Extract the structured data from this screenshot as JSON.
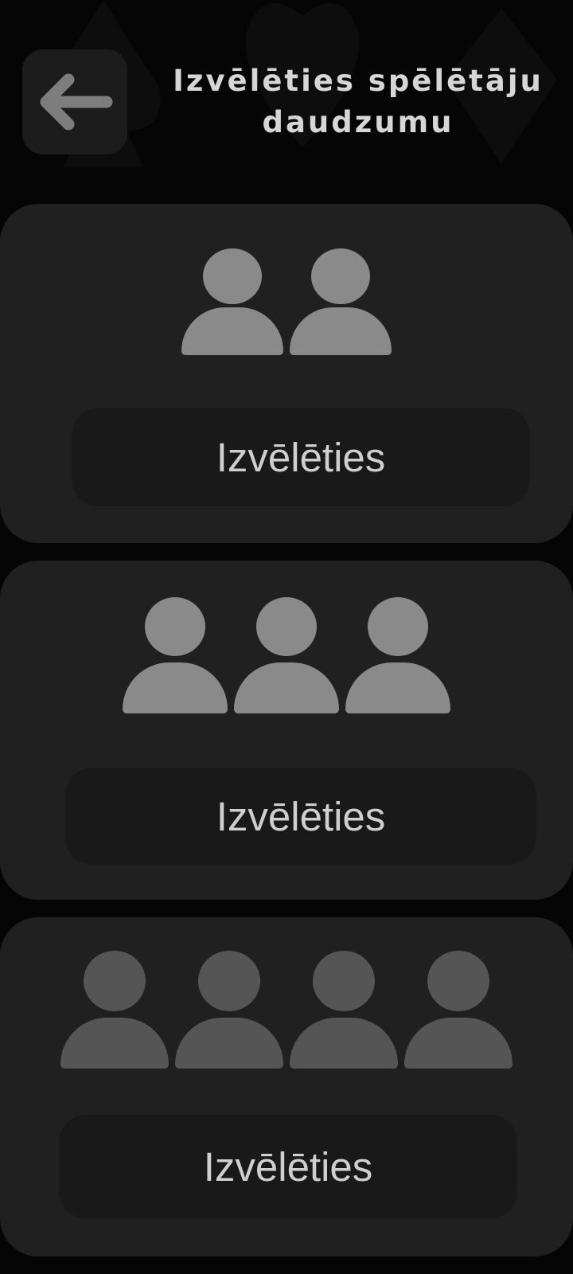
{
  "header": {
    "title_line1": "Izvēlēties spēlētāju",
    "title_line2": "daudzumu",
    "back_icon": "arrow-left-icon"
  },
  "options": [
    {
      "player_count": 2,
      "icon": "person-icon",
      "icon_color": "#8a8a8a",
      "button_label": "Izvēlēties"
    },
    {
      "player_count": 3,
      "icon": "person-icon",
      "icon_color": "#8a8a8a",
      "button_label": "Izvēlēties"
    },
    {
      "player_count": 4,
      "icon": "person-icon",
      "icon_color": "#555555",
      "button_label": "Izvēlēties"
    }
  ],
  "colors": {
    "background": "#050505",
    "card": "#202020",
    "button": "#191919",
    "text": "#cfcfcf"
  }
}
